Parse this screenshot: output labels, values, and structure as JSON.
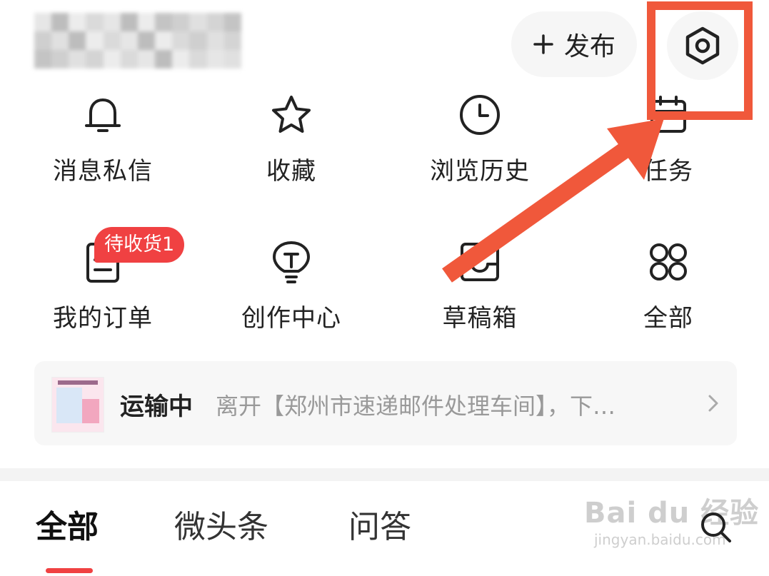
{
  "header": {
    "username_pixelated": true,
    "publish_label": "发布",
    "settings_icon": "settings-hexagon-icon"
  },
  "shortcuts": [
    {
      "label": "消息私信",
      "icon": "bell-icon"
    },
    {
      "label": "收藏",
      "icon": "star-icon"
    },
    {
      "label": "浏览历史",
      "icon": "clock-icon"
    },
    {
      "label": "任务",
      "icon": "calendar-icon"
    },
    {
      "label": "我的订单",
      "icon": "order-icon"
    },
    {
      "label": "创作中心",
      "icon": "lightbulb-icon"
    },
    {
      "label": "草稿箱",
      "icon": "drafts-icon"
    },
    {
      "label": "全部",
      "icon": "grid-icon"
    }
  ],
  "order_badge": "待收货1",
  "logistics": {
    "status": "运输中",
    "detail": "离开【郑州市速递邮件处理车间】，下…"
  },
  "tabs": [
    {
      "label": "全部",
      "active": true
    },
    {
      "label": "微头条",
      "active": false
    },
    {
      "label": "问答",
      "active": false
    }
  ],
  "watermark": {
    "main": "Bai du 经验",
    "sub": "jingyan.baidu.com"
  },
  "colors": {
    "accent_red": "#f04142",
    "annotation_orange": "#f0583b",
    "muted_text": "#999999"
  }
}
